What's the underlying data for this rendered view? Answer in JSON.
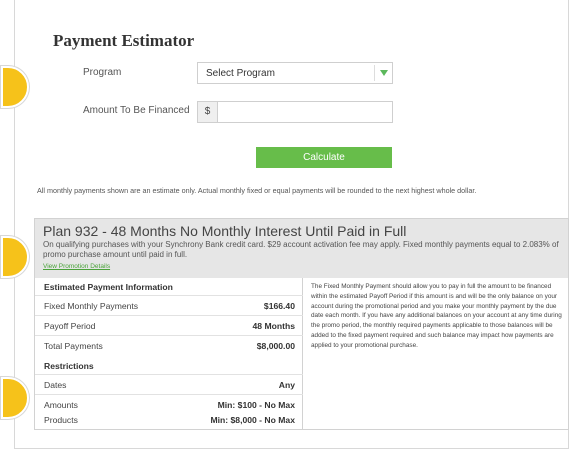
{
  "page": {
    "title": "Payment Estimator"
  },
  "form": {
    "program_label": "Program",
    "program_select_value": "Select Program",
    "amount_label": "Amount To Be Financed",
    "amount_prefix": "$",
    "amount_value": "",
    "calculate_label": "Calculate"
  },
  "disclaimer": "All monthly payments shown are an estimate only. Actual monthly fixed or equal payments will be rounded to the next highest whole dollar.",
  "plan": {
    "title": "Plan 932 - 48 Months No Monthly Interest Until Paid in Full",
    "description": "On qualifying purchases with your Synchrony Bank credit card. $29 account activation fee may apply. Fixed monthly payments equal to 2.083% of promo purchase amount until paid in full.",
    "view_details_label": "View Promotion Details",
    "estimated_heading": "Estimated Payment Information",
    "estimated_rows": [
      {
        "label": "Fixed Monthly Payments",
        "value": "$166.40"
      },
      {
        "label": "Payoff Period",
        "value": "48 Months"
      },
      {
        "label": "Total Payments",
        "value": "$8,000.00"
      }
    ],
    "restrictions_heading": "Restrictions",
    "restriction_rows": [
      {
        "label": "Dates",
        "value": "Any"
      },
      {
        "label": "Amounts",
        "value": "Min: $100 - No Max"
      },
      {
        "label": "Products",
        "value": "Min: $8,000 - No Max"
      }
    ],
    "explanation": "The Fixed Monthly Payment should allow you to pay in full the amount to be financed within the estimated Payoff Period if this amount is and will be the only balance on your account during the promotional period and you make your monthly payment by the due date each month. If you have any additional balances on your account at any time during the promo period, the monthly required payments applicable to those balances will be added to the fixed payment required and such balance may impact how payments are applied to your promotional purchase."
  },
  "colors": {
    "accent_green": "#67bd4a",
    "marker_yellow": "#f6c21a",
    "card_header_gray": "#e6e6e6"
  }
}
